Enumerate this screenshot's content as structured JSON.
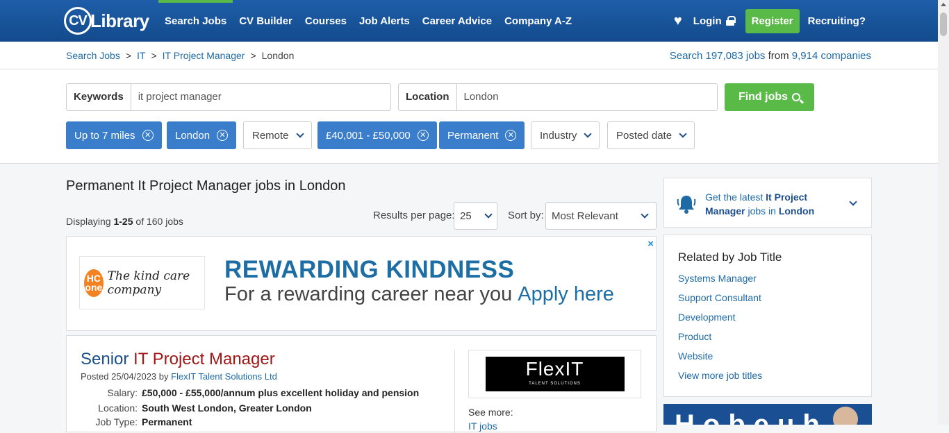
{
  "header": {
    "logo_text": "Library",
    "logo_cv": "CV",
    "nav": [
      "Search Jobs",
      "CV Builder",
      "Courses",
      "Job Alerts",
      "Career Advice",
      "Company A-Z"
    ],
    "login": "Login",
    "register": "Register",
    "recruiting": "Recruiting?"
  },
  "breadcrumb": {
    "items": [
      "Search Jobs",
      "IT",
      "IT Project Manager"
    ],
    "current": "London",
    "separator": ">"
  },
  "job_count": {
    "prefix": "Search",
    "jobs": "197,083 jobs",
    "middle": "from",
    "companies": "9,914 companies"
  },
  "search": {
    "keywords_label": "Keywords",
    "keywords_value": "it project manager",
    "location_label": "Location",
    "location_value": "London",
    "find_label": "Find jobs"
  },
  "filters": {
    "distance": "Up to 7 miles",
    "location": "London",
    "remote": "Remote",
    "salary": "£40,001 - £50,000",
    "type": "Permanent",
    "industry": "Industry",
    "posted": "Posted date",
    "remove_glyph": "⊗"
  },
  "results": {
    "title": "Permanent It Project Manager jobs in London",
    "displaying_prefix": "Displaying",
    "displaying_range": "1-25",
    "displaying_suffix": "of 160 jobs",
    "per_page_label": "Results per page:",
    "per_page_value": "25",
    "sort_label": "Sort by:",
    "sort_value": "Most Relevant"
  },
  "ad": {
    "logo_mark": "HC one",
    "logo_tagline": "The kind care company",
    "headline": "REWARDING KINDNESS",
    "subline": "For a rewarding career near you",
    "apply": "Apply here",
    "close": "×"
  },
  "job": {
    "title_prefix": "Senior ",
    "title_highlight": "IT Project Manager",
    "posted_prefix": "Posted 25/04/2023 by",
    "company": "FlexIT Talent Solutions Ltd",
    "salary_label": "Salary:",
    "salary": "£50,000 - £55,000/annum plus excellent holiday and pension",
    "location_label": "Location:",
    "location": "South West London, Greater London",
    "type_label": "Job Type:",
    "type": "Permanent",
    "company_logo_big": "FlexIT",
    "company_logo_small": "TALENT SOLUTIONS",
    "see_more": "See more:",
    "see_more_link": "IT jobs"
  },
  "alert": {
    "prefix": "Get the latest",
    "title": "It Project Manager",
    "middle": "jobs in",
    "location": "London"
  },
  "related": {
    "heading": "Related by Job Title",
    "items": [
      "Systems Manager",
      "Support Consultant",
      "Development",
      "Product",
      "Website",
      "View more job titles"
    ]
  },
  "banner": {
    "text": "Hobeuh"
  }
}
